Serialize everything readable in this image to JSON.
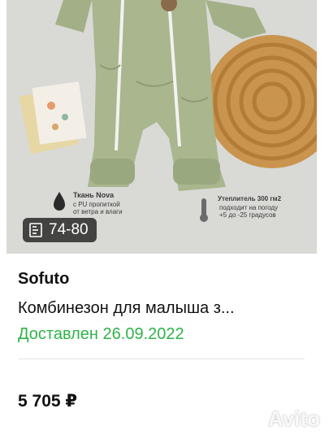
{
  "listing": {
    "seller": "Sofuto",
    "title": "Комбинезон для малыша з...",
    "status": "Доставлен 26.09.2022",
    "price": "5 705 ₽",
    "size_badge": "74-80"
  },
  "image_labels": {
    "fabric_title": "Ткань Nova",
    "fabric_desc_1": "с PU пропиткой",
    "fabric_desc_2": "от ветра и влаги",
    "insulation_title": "Утеплитель 300 гм2",
    "insulation_desc_1": "подходит на погоду",
    "insulation_desc_2": "+5 до -25 градусов"
  },
  "watermark": "Avito",
  "icons": [
    "ruler-icon",
    "avito-logo-icon",
    "water-drop-icon",
    "thermometer-icon"
  ],
  "colors": {
    "status_green": "#2fb34a",
    "badge_bg": "#282828",
    "garment_green": "#a9b68e"
  }
}
